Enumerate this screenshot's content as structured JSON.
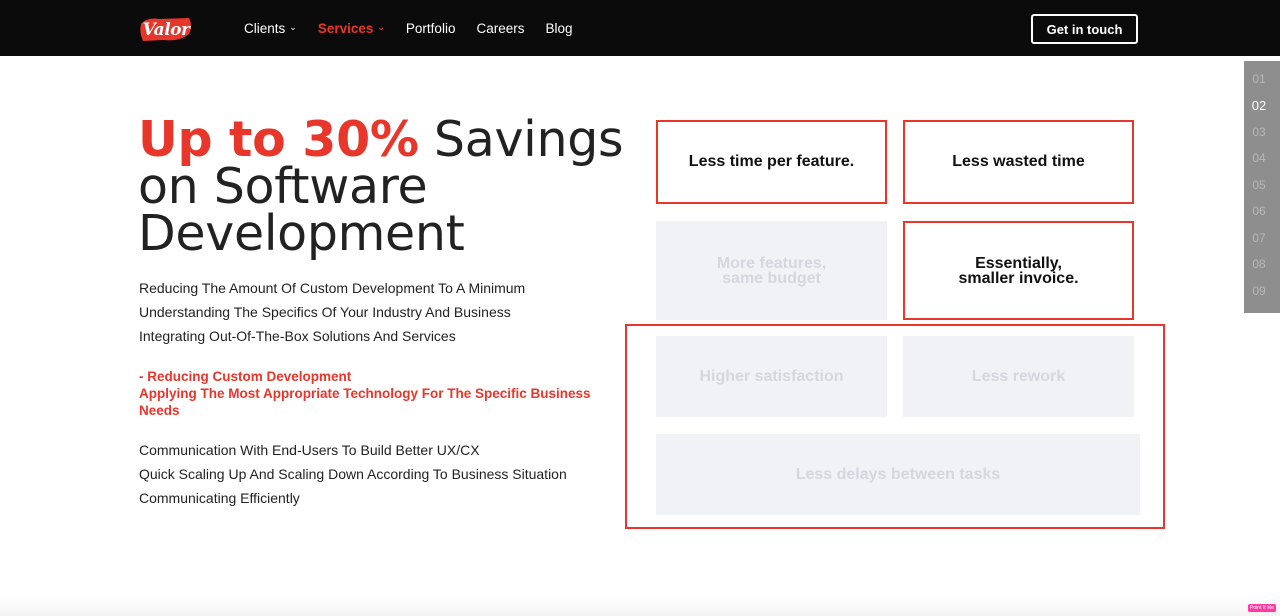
{
  "header": {
    "logo_text": "Valor",
    "nav": [
      {
        "label": "Clients",
        "has_dropdown": true,
        "active": false
      },
      {
        "label": "Services",
        "has_dropdown": true,
        "active": true
      },
      {
        "label": "Portfolio",
        "has_dropdown": false,
        "active": false
      },
      {
        "label": "Careers",
        "has_dropdown": false,
        "active": false
      },
      {
        "label": "Blog",
        "has_dropdown": false,
        "active": false
      }
    ],
    "cta_label": "Get in touch"
  },
  "hero": {
    "headline_highlight": "Up to 30%",
    "headline_rest_1": " Savings",
    "headline_rest_2": "on Software",
    "headline_rest_3": "Development"
  },
  "bullets_1": [
    "Reducing The Amount Of Custom Development To A Minimum",
    "Understanding The Specifics Of Your Industry And Business",
    "Integrating Out-Of-The-Box Solutions And Services"
  ],
  "highlight_block": {
    "line_1": "- Reducing Custom Development",
    "line_2": "Applying The Most Appropriate Technology For The Specific Business Needs"
  },
  "bullets_2": [
    "Communication With End-Users To Build Better UX/CX",
    "Quick Scaling Up And Scaling Down According To Business Situation",
    "Communicating Efficiently"
  ],
  "features": {
    "less_time": "Less time per feature.",
    "less_wasted": "Less wasted time",
    "more_features_1": "More features,",
    "more_features_2": "same budget",
    "smaller_invoice_1": "Essentially,",
    "smaller_invoice_2": "smaller invoice.",
    "higher_satisfaction": "Higher satisfaction",
    "less_rework": "Less rework",
    "less_delays": "Less delays between tasks"
  },
  "pager": {
    "items": [
      "01",
      "02",
      "03",
      "04",
      "05",
      "06",
      "07",
      "08",
      "09"
    ],
    "current": "02"
  },
  "badge_text": "Point It Me",
  "colors": {
    "accent": "#e8362a",
    "header_bg": "#0b0b0b",
    "inactive_card": "#f1f2f6",
    "pager_bg": "#8e8e8e"
  }
}
